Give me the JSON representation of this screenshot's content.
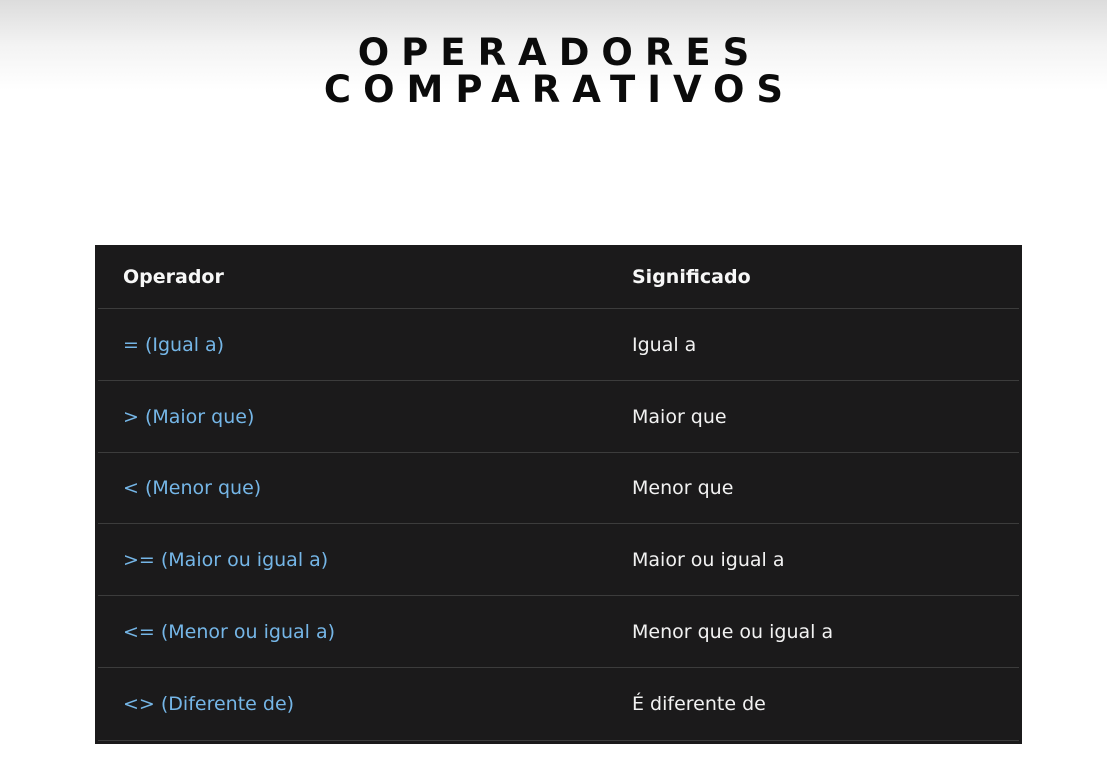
{
  "title": {
    "line1": "OPERADORES",
    "line2": "COMPARATIVOS"
  },
  "table": {
    "headers": {
      "operator": "Operador",
      "meaning": "Significado"
    },
    "rows": [
      {
        "operator": "= (Igual a)",
        "meaning": "Igual a"
      },
      {
        "operator": "> (Maior que)",
        "meaning": "Maior que"
      },
      {
        "operator": "< (Menor que)",
        "meaning": "Menor que"
      },
      {
        "operator": ">= (Maior ou igual a)",
        "meaning": "Maior ou igual a"
      },
      {
        "operator": "<= (Menor ou igual a)",
        "meaning": "Menor que ou igual a"
      },
      {
        "operator": "<> (Diferente de)",
        "meaning": "É diferente de"
      }
    ]
  },
  "colors": {
    "table_background": "#1b1a1b",
    "operator_text": "#75b6e7",
    "meaning_text": "#f2f2f2"
  }
}
